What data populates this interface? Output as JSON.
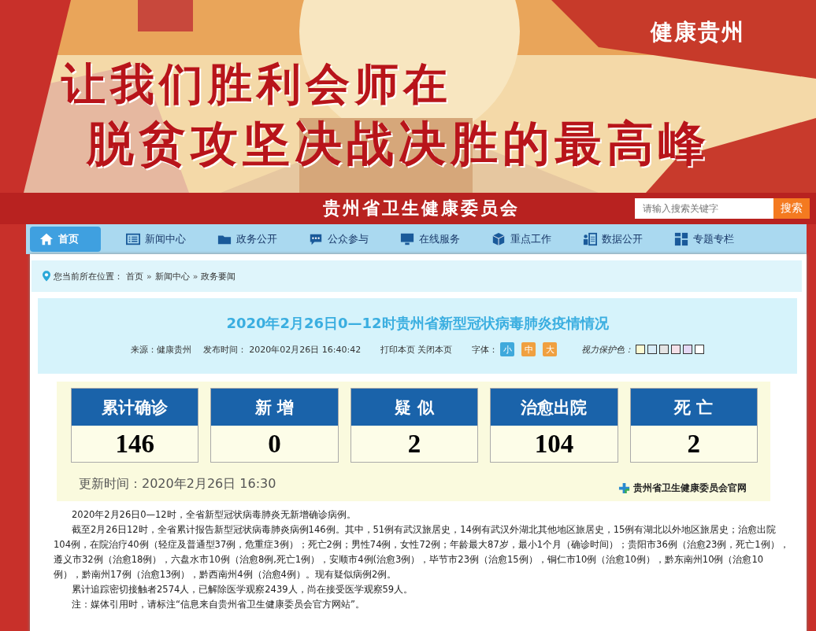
{
  "banner": {
    "badge": "健康贵州",
    "slogan_lines": [
      "让我们胜利会师在",
      "脱贫攻坚决战决胜的最高峰"
    ]
  },
  "header": {
    "site_title": "贵州省卫生健康委员会",
    "search": {
      "placeholder": "请输入搜索关键字",
      "button": "搜索"
    }
  },
  "nav": [
    {
      "label": "首页",
      "selected": true
    },
    {
      "label": "新闻中心",
      "selected": false
    },
    {
      "label": "政务公开",
      "selected": false
    },
    {
      "label": "公众参与",
      "selected": false
    },
    {
      "label": "在线服务",
      "selected": false
    },
    {
      "label": "重点工作",
      "selected": false
    },
    {
      "label": "数据公开",
      "selected": false
    },
    {
      "label": "专题专栏",
      "selected": false
    }
  ],
  "breadcrumb": {
    "prefix": "您当前所在位置：",
    "items": [
      "首页",
      "新闻中心",
      "政务要闻"
    ],
    "separator": "»"
  },
  "article": {
    "title": "2020年2月26日0—12时贵州省新型冠状病毒肺炎疫情情况",
    "source": "来源：健康贵州",
    "published": "发布时间：  2020年02月26日 16:40:42",
    "print": "打印本页",
    "close": "关闭本页",
    "font_label": "字体：",
    "font_sizes": [
      {
        "label": "小",
        "selected": true
      },
      {
        "label": "中",
        "selected": false
      },
      {
        "label": "大",
        "selected": false
      }
    ],
    "eye_label": "视力保护色：",
    "eye_colors": [
      {
        "color": "#fafad2"
      },
      {
        "color": "#d8ecf8"
      },
      {
        "color": "#e4e4e4"
      },
      {
        "color": "#f4e0e8"
      },
      {
        "color": "#e4d8f4"
      },
      {
        "color": "#ffffff"
      }
    ]
  },
  "stats": {
    "cards": [
      {
        "label": "累计确诊",
        "value": "146"
      },
      {
        "label": "新 增",
        "value": "0"
      },
      {
        "label": "疑 似",
        "value": "2"
      },
      {
        "label": "治愈出院",
        "value": "104"
      },
      {
        "label": "死 亡",
        "value": "2"
      }
    ],
    "updated": "更新时间：2020年2月26日  16:30",
    "official": "贵州省卫生健康委员会官网"
  },
  "paragraphs": [
    "2020年2月26日0—12时，全省新型冠状病毒肺炎无新增确诊病例。",
    "截至2月26日12时，全省累计报告新型冠状病毒肺炎病例146例。其中，51例有武汉旅居史，14例有武汉外湖北其他地区旅居史，15例有湖北以外地区旅居史；治愈出院104例，在院治疗40例（轻症及普通型37例，危重症3例）；死亡2例；男性74例，女性72例；年龄最大87岁，最小1个月（确诊时间）；贵阳市36例（治愈23例，死亡1例），遵义市32例（治愈18例），六盘水市10例（治愈8例,死亡1例），安顺市4例(治愈3例），毕节市23例（治愈15例），铜仁市10例（治愈10例），黔东南州10例（治愈10例），黔南州17例（治愈13例），黔西南州4例（治愈4例）。现有疑似病例2例。",
    "累计追踪密切接触者2574人，已解除医学观察2439人，尚在接受医学观察59人。",
    "注：媒体引用时，请标注“信息来自贵州省卫生健康委员会官方网站”。"
  ]
}
